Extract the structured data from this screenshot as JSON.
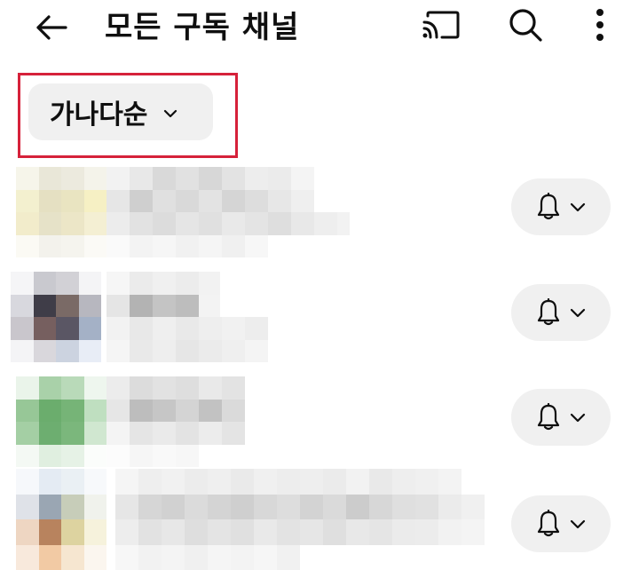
{
  "header": {
    "title": "모든 구독 채널",
    "back_icon": "arrow-left-icon",
    "cast_icon": "cast-icon",
    "search_icon": "search-icon",
    "more_icon": "more-vertical-icon"
  },
  "sort": {
    "label": "가나다순",
    "icon": "chevron-down-icon",
    "highlight_color": "#d6213a"
  },
  "channels": [
    {
      "notification_icon": "bell-icon",
      "dropdown_icon": "chevron-down-icon"
    },
    {
      "notification_icon": "bell-icon",
      "dropdown_icon": "chevron-down-icon"
    },
    {
      "notification_icon": "bell-icon",
      "dropdown_icon": "chevron-down-icon"
    },
    {
      "notification_icon": "bell-icon",
      "dropdown_icon": "chevron-down-icon"
    }
  ],
  "colors": {
    "chip_background": "#f0f0f0",
    "text": "#0f0f0f"
  }
}
